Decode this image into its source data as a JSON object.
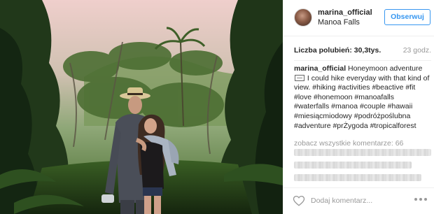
{
  "post": {
    "image_alt": "Couple hiking in tropical jungle at Manoa Falls"
  },
  "header": {
    "username": "marina_official",
    "location": "Manoa Falls",
    "follow_label": "Obserwuj"
  },
  "stats": {
    "likes": "Liczba polubień: 30,3tys.",
    "time": "23 godz."
  },
  "caption": {
    "username": "marina_official",
    "text_part1": "Honeymoon adventure",
    "text_part2": "I could hike everyday with that kind of view. #hiking #activities #beactive #fit #love #honemoon #manoafalls #waterfalls #manoa #couple #hawaii #miesiącmiodowy #podróżpoślubna #adventure #prŻygoda #tropicalforest"
  },
  "comments": {
    "view_all": "zobacz wszystkie komentarze: 66"
  },
  "footer": {
    "comment_placeholder": "Dodaj komentarz..."
  },
  "icons": {
    "like": "heart-outline-icon",
    "more": "ellipsis-icon",
    "emoji_missing": "missing-glyph-box-icon"
  },
  "colors": {
    "accent": "#3897f0",
    "muted_text": "#999999",
    "text": "#262626",
    "border": "#efefef"
  }
}
